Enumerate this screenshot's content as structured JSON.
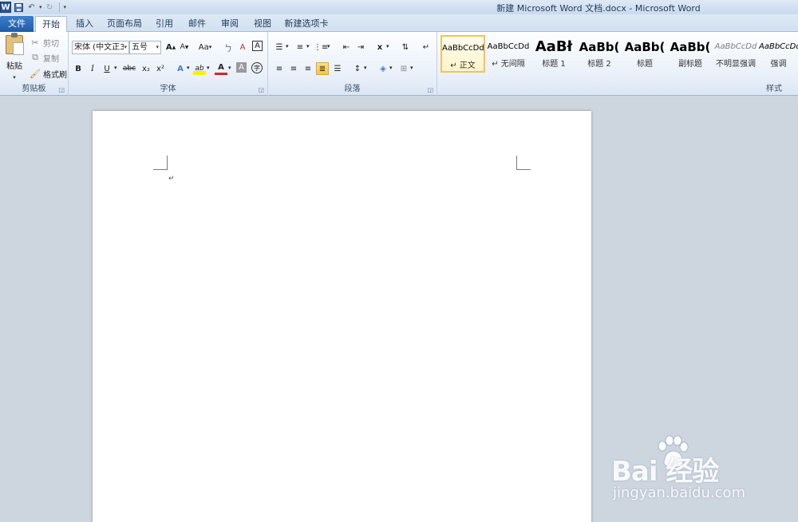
{
  "titlebar": {
    "app_icon_letter": "W",
    "title": "新建 Microsoft Word 文档.docx - Microsoft Word"
  },
  "tabs": [
    {
      "label": "文件"
    },
    {
      "label": "开始"
    },
    {
      "label": "插入"
    },
    {
      "label": "页面布局"
    },
    {
      "label": "引用"
    },
    {
      "label": "邮件"
    },
    {
      "label": "审阅"
    },
    {
      "label": "视图"
    },
    {
      "label": "新建选项卡"
    }
  ],
  "clipboard": {
    "paste": "粘贴",
    "cut": "剪切",
    "copy": "复制",
    "format_painter": "格式刷",
    "group_label": "剪贴板"
  },
  "font": {
    "font_name": "宋体 (中文正3",
    "font_size": "五号",
    "grow": "A",
    "shrink": "A",
    "change_case": "Aa",
    "phonetic": "ㄅ",
    "char_border": "A",
    "bold": "B",
    "italic": "I",
    "underline": "U",
    "strikethrough": "abc",
    "subscript": "x₂",
    "superscript": "x²",
    "text_effects": "A",
    "highlight": "ab",
    "font_color": "A",
    "char_shading": "A",
    "enclose": "字",
    "group_label": "字体"
  },
  "paragraph": {
    "group_label": "段落"
  },
  "styles": {
    "items": [
      {
        "preview": "AaBbCcDd",
        "name": "↵ 正文"
      },
      {
        "preview": "AaBbCcDd",
        "name": "↵ 无间隔"
      },
      {
        "preview": "AaBł",
        "name": "标题 1"
      },
      {
        "preview": "AaBb(",
        "name": "标题 2"
      },
      {
        "preview": "AaBb(",
        "name": "标题"
      },
      {
        "preview": "AaBb(",
        "name": "副标题"
      },
      {
        "preview": "AaBbCcDd",
        "name": "不明显强调"
      },
      {
        "preview": "AaBbCcDd",
        "name": "强调"
      }
    ],
    "group_label": "样式"
  },
  "document": {
    "paragraph_mark": "↵"
  },
  "watermark": {
    "brand": "Bai  经验",
    "url": "jingyan.baidu.com"
  },
  "colors": {
    "accent": "#2b5797",
    "file_tab": "#2a6ac0",
    "highlight_yellow": "#f7c64c",
    "font_red": "#d8261c"
  }
}
